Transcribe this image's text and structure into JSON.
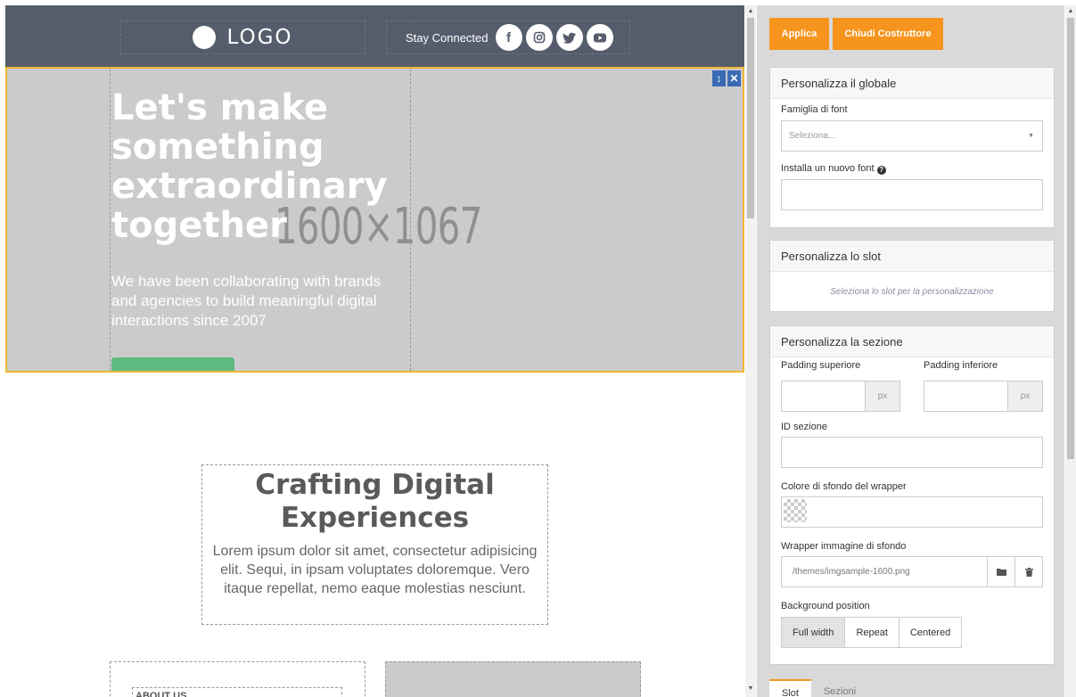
{
  "header": {
    "logo_text": "LOGO",
    "social_label": "Stay Connected",
    "social_icons": [
      "facebook-icon",
      "instagram-icon",
      "twitter-icon",
      "youtube-icon"
    ]
  },
  "hero": {
    "title": "Let's make something extraordinary together",
    "placeholder_size": "1600×1067",
    "subtitle": "We have been collaborating with brands and agencies to build meaningful digital interactions since 2007"
  },
  "crafting": {
    "title": "Crafting Digital Experiences",
    "body": "Lorem ipsum dolor sit amet, consectetur adipisicing elit. Sequi, in ipsam voluptates doloremque. Vero itaque repellat, nemo eaque molestias nesciunt."
  },
  "about": {
    "label": "ABOUT US"
  },
  "panel": {
    "apply_label": "Applica",
    "close_label": "Chiudi Costruttore",
    "global": {
      "title": "Personalizza il globale",
      "font_family_label": "Famiglia di font",
      "font_family_placeholder": "Seleziona...",
      "install_font_label": "Installa un nuovo font"
    },
    "slot": {
      "title": "Personalizza lo slot",
      "hint": "Seleziona lo slot per la personalizzazione"
    },
    "section": {
      "title": "Personalizza la sezione",
      "padding_top_label": "Padding superiore",
      "padding_bottom_label": "Padding inferiore",
      "unit": "px",
      "section_id_label": "ID sezione",
      "wrapper_bg_color_label": "Colore di sfondo del wrapper",
      "wrapper_bg_image_label": "Wrapper immagine di sfondo",
      "wrapper_bg_image_value": "/themes/imgsample-1600.png",
      "bg_position_label": "Background position",
      "bg_position_options": [
        "Full width",
        "Repeat",
        "Centered"
      ],
      "bg_position_selected": "Full width"
    },
    "tabs": [
      "Slot",
      "Sezioni"
    ],
    "active_tab": "Slot"
  },
  "colors": {
    "header_bg": "#555d6c",
    "hero_bg": "#cbcbcc",
    "selection_border": "#f2b632",
    "accent": "#f7941d",
    "cta_green": "#5dbb82"
  }
}
